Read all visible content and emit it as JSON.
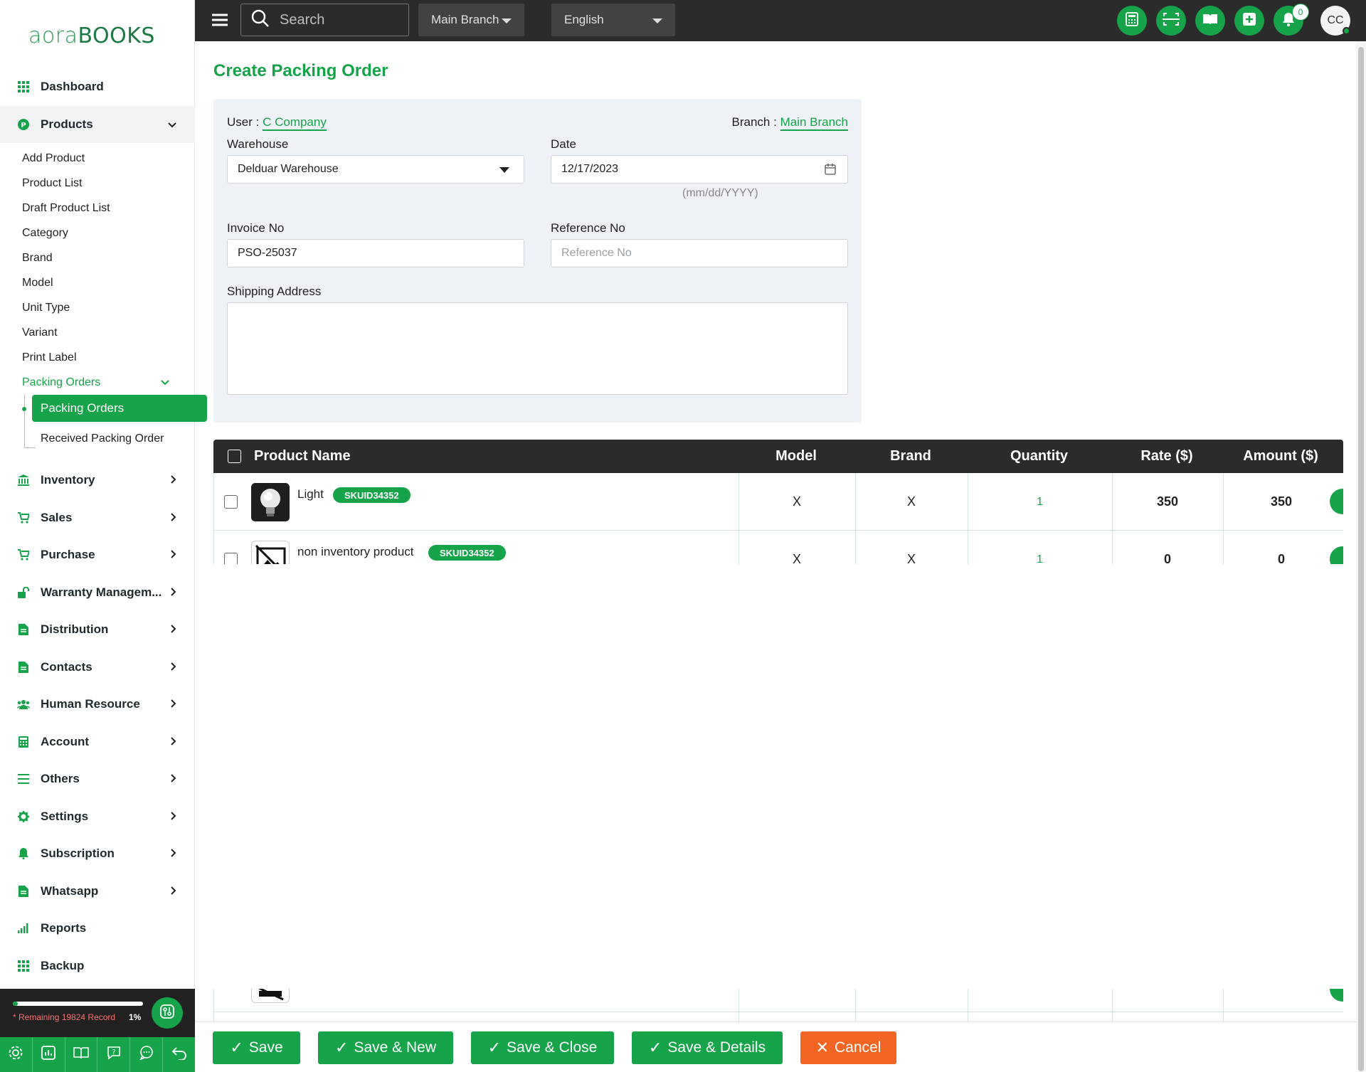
{
  "app": {
    "logo_part1": "aora",
    "logo_part2": "BOOKS"
  },
  "topbar": {
    "search_placeholder": "Search",
    "branch": "Main Branch",
    "language": "English",
    "notification_count": "0",
    "avatar_initials": "CC"
  },
  "sidebar": {
    "dashboard": "Dashboard",
    "products": "Products",
    "product_sub": [
      "Add Product",
      "Product List",
      "Draft Product List",
      "Category",
      "Brand",
      "Model",
      "Unit Type",
      "Variant",
      "Print Label"
    ],
    "packing_orders_group": "Packing Orders",
    "packing_orders_active": "Packing Orders",
    "received_packing_order": "Received Packing Order",
    "sections": [
      "Inventory",
      "Sales",
      "Purchase",
      "Warranty Managem...",
      "Distribution",
      "Contacts",
      "Human Resource",
      "Account",
      "Others",
      "Settings",
      "Subscription",
      "Whatsapp"
    ],
    "reports": "Reports",
    "backup": "Backup",
    "records_remaining": "* Remaining 19824 Record",
    "records_percent": "1%",
    "records_progress": 0.01
  },
  "page": {
    "title": "Create Packing Order",
    "user_label": "User :",
    "user_value": "C Company",
    "branch_label": "Branch :",
    "branch_value": "Main Branch",
    "warehouse_label": "Warehouse",
    "warehouse_value": "Delduar Warehouse",
    "date_label": "Date",
    "date_value": "12/17/2023",
    "date_hint": "(mm/dd/YYYY)",
    "invoice_label": "Invoice No",
    "invoice_value": "PSO-25037",
    "reference_label": "Reference No",
    "reference_placeholder": "Reference No",
    "shipping_label": "Shipping Address"
  },
  "table": {
    "headers": {
      "product": "Product Name",
      "model": "Model",
      "brand": "Brand",
      "quantity": "Quantity",
      "rate": "Rate ($)",
      "amount": "Amount ($)"
    },
    "rows": [
      {
        "name": "Light",
        "sku": "SKUID34352",
        "model": "X",
        "brand": "X",
        "quantity": "1",
        "rate": "350",
        "amount": "350"
      },
      {
        "name": "non inventory product",
        "sku": "SKUID34352",
        "model": "X",
        "brand": "X",
        "quantity": "1",
        "rate": "0",
        "amount": "0"
      }
    ]
  },
  "footer": {
    "save": "Save",
    "save_new": "Save & New",
    "save_close": "Save & Close",
    "save_details": "Save & Details",
    "cancel": "Cancel"
  },
  "colors": {
    "accent": "#16a34a",
    "cancel": "#f26522",
    "topbar": "#2b2b2b"
  }
}
